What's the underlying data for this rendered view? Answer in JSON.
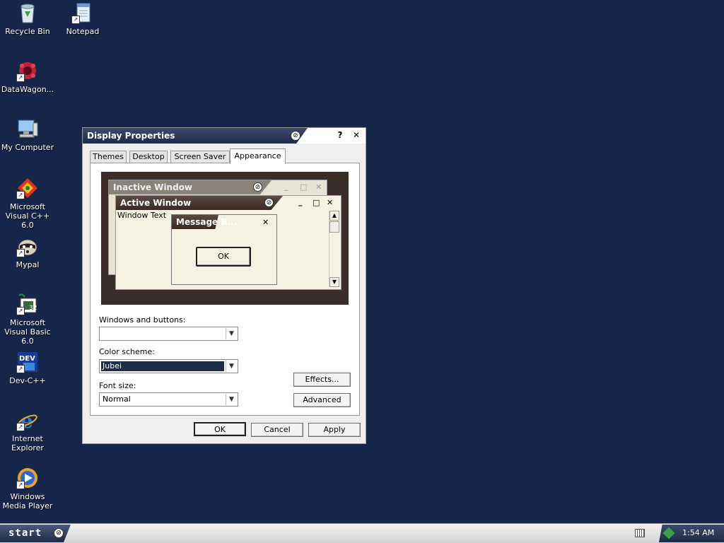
{
  "desktop": {
    "icons": [
      {
        "label": "Recycle Bin"
      },
      {
        "label": "Notepad"
      },
      {
        "label": "DataWagon..."
      },
      {
        "label": "My Computer"
      },
      {
        "label": "Microsoft Visual C++ 6.0"
      },
      {
        "label": "Mypal"
      },
      {
        "label": "Microsoft Visual Basic 6.0"
      },
      {
        "label": "Dev-C++"
      },
      {
        "label": "Internet Explorer"
      },
      {
        "label": "Windows Media Player"
      }
    ]
  },
  "dialog": {
    "title": "Display Properties",
    "help": "?",
    "close": "✕",
    "tabs": [
      "Themes",
      "Desktop",
      "Screen Saver",
      "Appearance"
    ],
    "active_tab": "Appearance",
    "preview": {
      "inactive_title": "Inactive Window",
      "active_title": "Active Window",
      "window_text": "Window Text",
      "message_title": "Message B...",
      "message_ok": "OK",
      "min": "_",
      "max": "□",
      "close": "✕"
    },
    "windows_buttons_label": "Windows and buttons:",
    "windows_buttons_value": "",
    "color_scheme_label": "Color scheme:",
    "color_scheme_value": "Jubei",
    "font_size_label": "Font size:",
    "font_size_value": "Normal",
    "effects_button": "Effects...",
    "advanced_button": "Advanced",
    "ok_button": "OK",
    "cancel_button": "Cancel",
    "apply_button": "Apply"
  },
  "taskbar": {
    "start_label": "start",
    "clock": "1:54 AM"
  },
  "colors": {
    "desktop": "#16264a",
    "titlebar": "#1c2b48",
    "preview_bg": "#3b2d28",
    "selection": "#1c2b48"
  }
}
